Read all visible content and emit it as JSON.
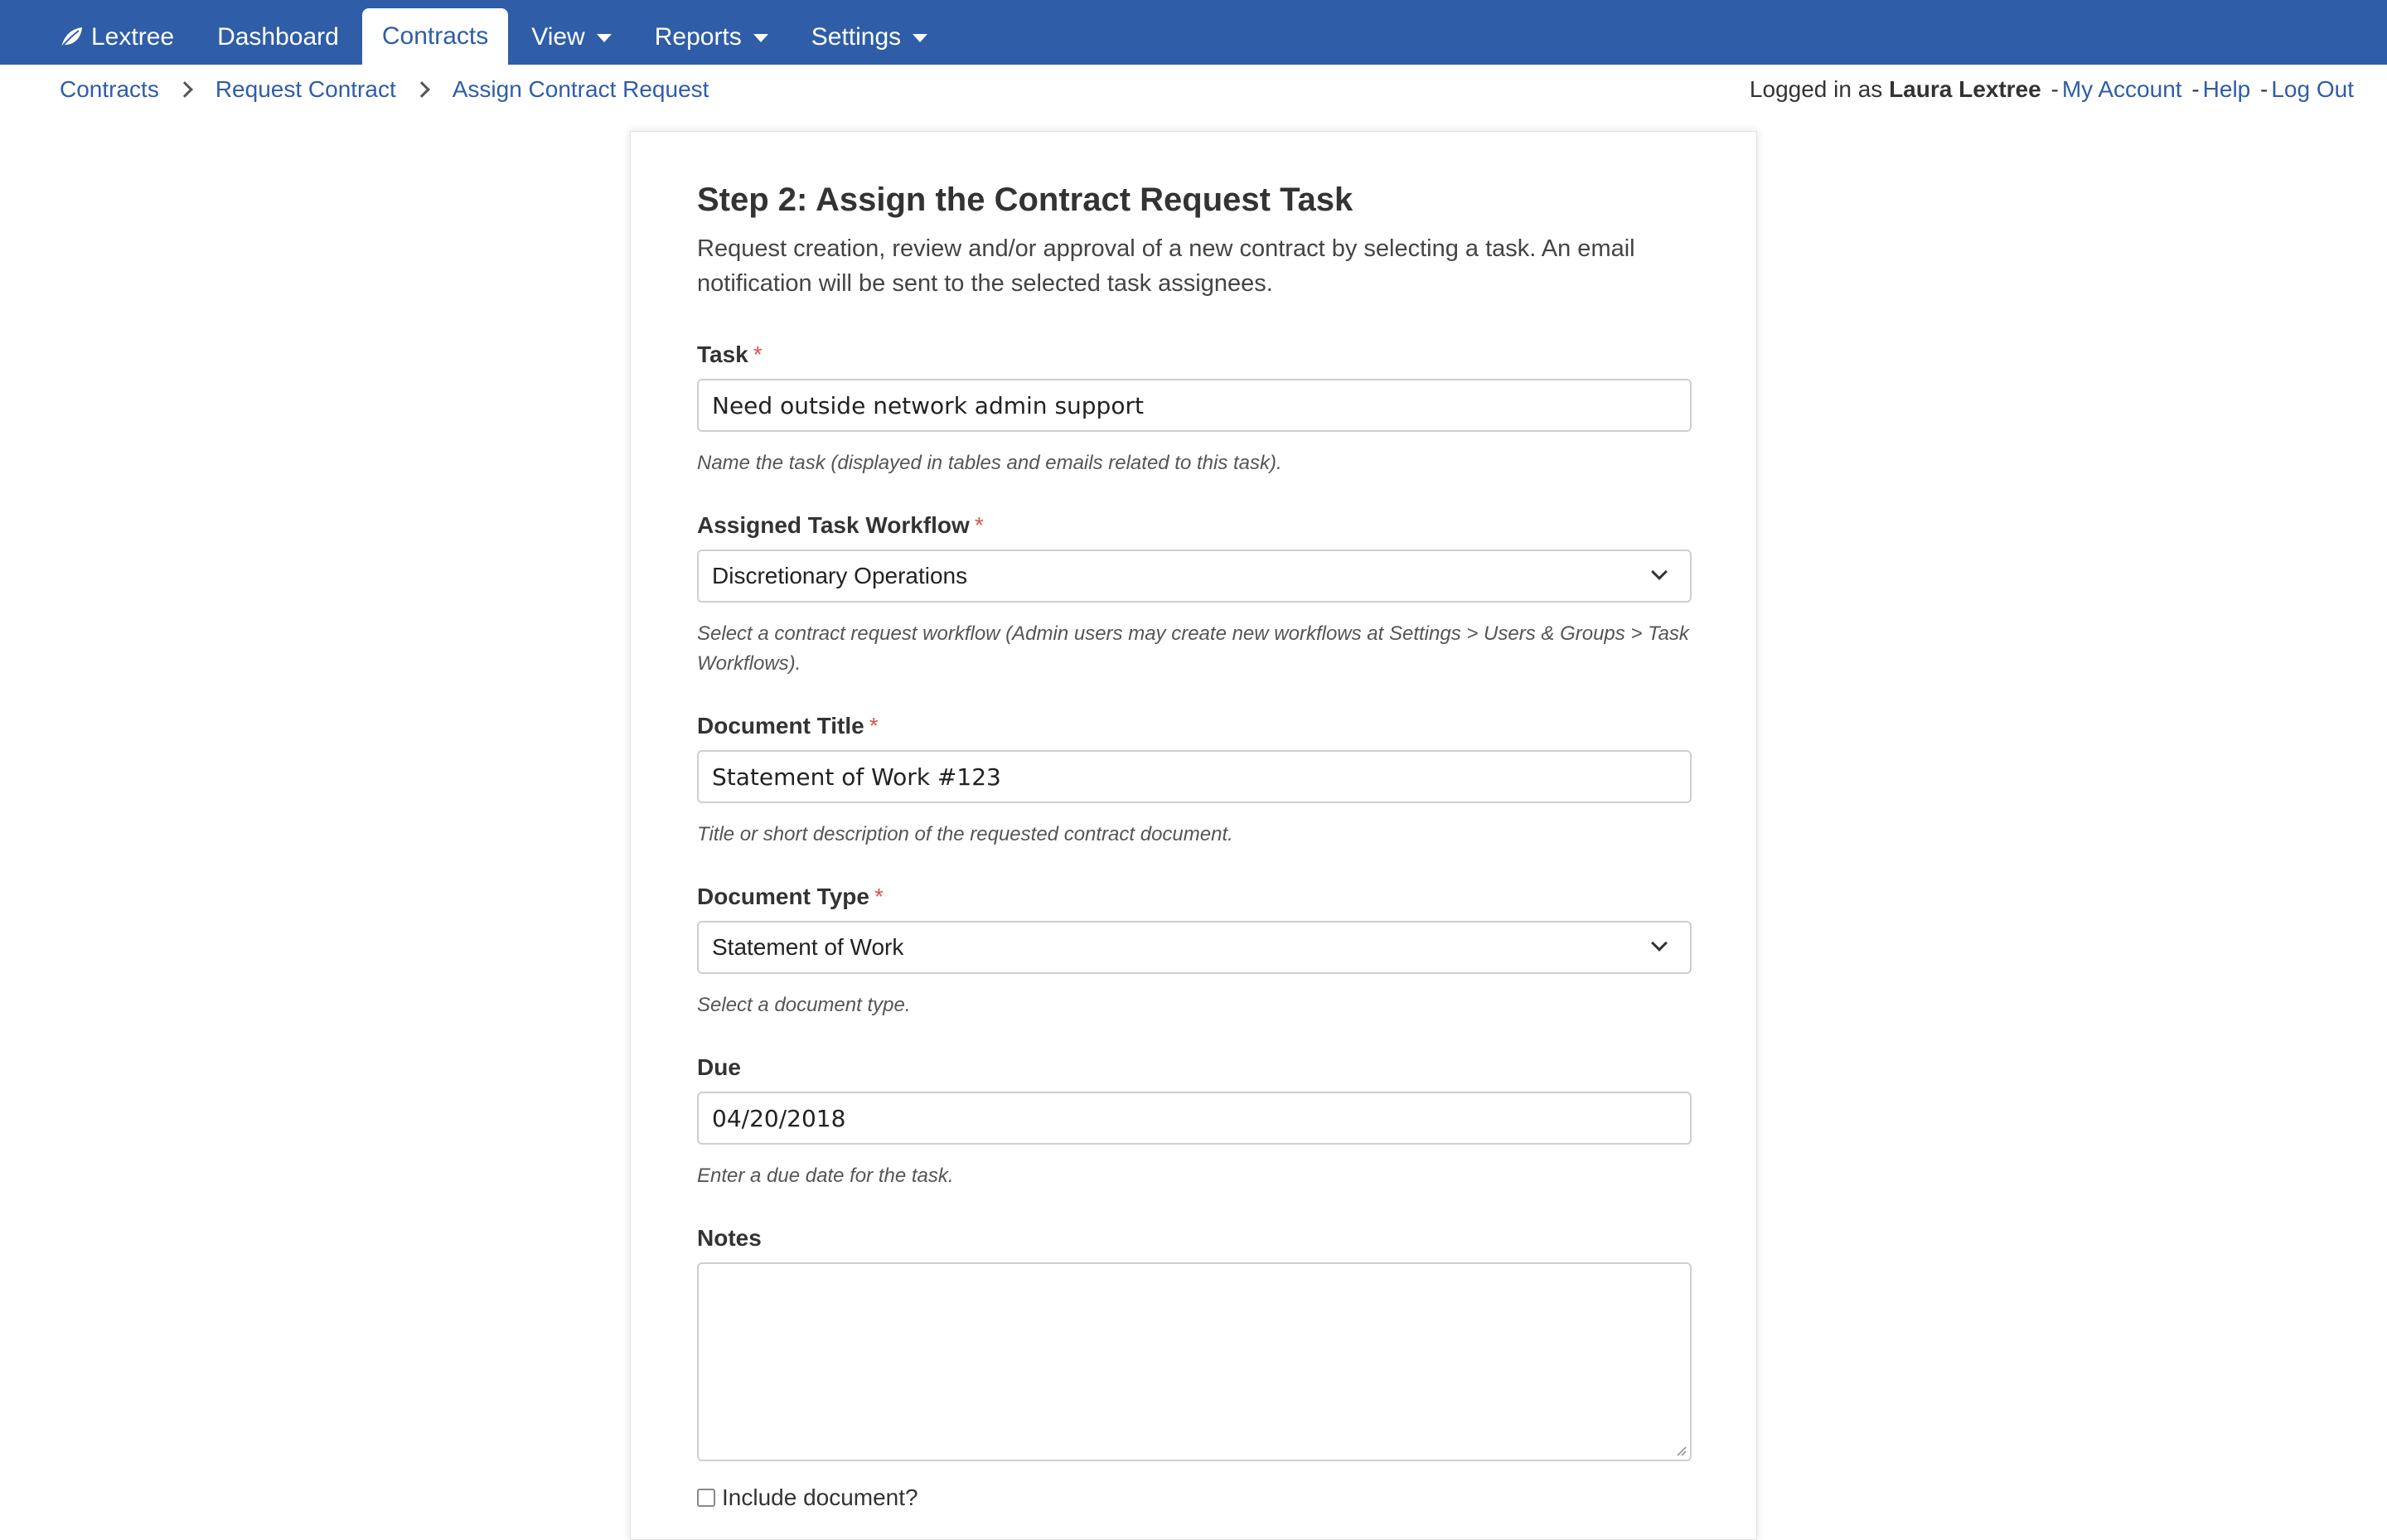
{
  "nav": {
    "brand": "Lextree",
    "items": [
      {
        "label": "Dashboard",
        "active": false,
        "dropdown": false
      },
      {
        "label": "Contracts",
        "active": true,
        "dropdown": false
      },
      {
        "label": "View",
        "active": false,
        "dropdown": true
      },
      {
        "label": "Reports",
        "active": false,
        "dropdown": true
      },
      {
        "label": "Settings",
        "active": false,
        "dropdown": true
      }
    ],
    "bar_color": "#2f5da8"
  },
  "breadcrumb": [
    "Contracts",
    "Request Contract",
    "Assign Contract Request"
  ],
  "account": {
    "prefix": "Logged in as",
    "user": "Laura Lextree",
    "links": [
      "My Account",
      "Help",
      "Log Out"
    ],
    "separator": "-"
  },
  "form": {
    "title": "Step 2: Assign the Contract Request Task",
    "intro": "Request creation, review and/or approval of a new contract by selecting a task. An email notification will be sent to the selected task assignees.",
    "required_marker": "*",
    "fields": {
      "task": {
        "label": "Task",
        "value": "Need outside network admin support",
        "help": "Name the task (displayed in tables and emails related to this task)."
      },
      "workflow": {
        "label": "Assigned Task Workflow",
        "value": "Discretionary Operations",
        "help": "Select a contract request workflow (Admin users may create new workflows at Settings > Users & Groups > Task Workflows)."
      },
      "doc_title": {
        "label": "Document Title",
        "value": "Statement of Work #123",
        "help": "Title or short description of the requested contract document."
      },
      "doc_type": {
        "label": "Document Type",
        "value": "Statement of Work",
        "help": "Select a document type."
      },
      "due": {
        "label": "Due",
        "value": "04/20/2018",
        "help": "Enter a due date for the task."
      },
      "notes": {
        "label": "Notes",
        "value": ""
      },
      "include_document": {
        "label": "Include document?",
        "checked": false
      }
    }
  }
}
